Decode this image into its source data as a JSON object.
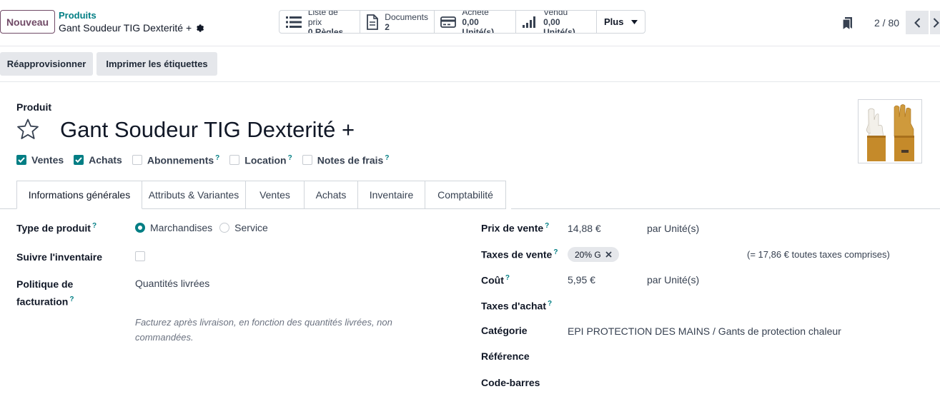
{
  "header": {
    "new_button": "Nouveau",
    "breadcrumb_parent": "Produits",
    "breadcrumb_current": "Gant Soudeur TIG Dexterité +",
    "stats": [
      {
        "label": "Liste de prix",
        "value": "0 Règles",
        "icon": "list-icon"
      },
      {
        "label": "Documents",
        "value": "2",
        "icon": "document-icon"
      },
      {
        "label": "Acheté",
        "value": "0,00 Unité(s)",
        "icon": "credit-card-icon"
      },
      {
        "label": "Vendu",
        "value": "0,00 Unité(s)",
        "icon": "signal-bars-icon"
      }
    ],
    "more_label": "Plus",
    "pager": "2 / 80"
  },
  "actions": {
    "replenish": "Réapprovisionner",
    "print_labels": "Imprimer les étiquettes"
  },
  "product": {
    "type_label": "Produit",
    "name": "Gant Soudeur TIG Dexterité +",
    "flags": [
      {
        "label": "Ventes",
        "checked": true,
        "help": false
      },
      {
        "label": "Achats",
        "checked": true,
        "help": false
      },
      {
        "label": "Abonnements",
        "checked": false,
        "help": true
      },
      {
        "label": "Location",
        "checked": false,
        "help": true
      },
      {
        "label": "Notes de frais",
        "checked": false,
        "help": true
      }
    ]
  },
  "tabs": [
    "Informations générales",
    "Attributs & Variantes",
    "Ventes",
    "Achats",
    "Inventaire",
    "Comptabilité"
  ],
  "left": {
    "product_type_label": "Type de produit",
    "product_type_options": [
      "Marchandises",
      "Service"
    ],
    "track_inventory_label": "Suivre l'inventaire",
    "invoice_policy_label_1": "Politique de",
    "invoice_policy_label_2": "facturation",
    "invoice_policy_value": "Quantités livrées",
    "invoice_policy_hint": "Facturez après livraison, en fonction des quantités livrées, non commandées."
  },
  "right": {
    "sale_price_label": "Prix de vente",
    "sale_price_value": "14,88 €",
    "sale_price_unit": "par Unité(s)",
    "sale_taxes_label": "Taxes de vente",
    "sale_taxes_tag": "20% G",
    "sale_taxes_incl": "(= 17,86 € toutes taxes comprises)",
    "cost_label": "Coût",
    "cost_value": "5,95 €",
    "cost_unit": "par Unité(s)",
    "purchase_taxes_label": "Taxes d'achat",
    "category_label": "Catégorie",
    "category_value": "EPI PROTECTION DES MAINS / Gants de protection chaleur",
    "reference_label": "Référence",
    "barcode_label": "Code-barres"
  },
  "help_mark": "?",
  "colors": {
    "accent": "#017e84",
    "brand": "#714b67"
  }
}
